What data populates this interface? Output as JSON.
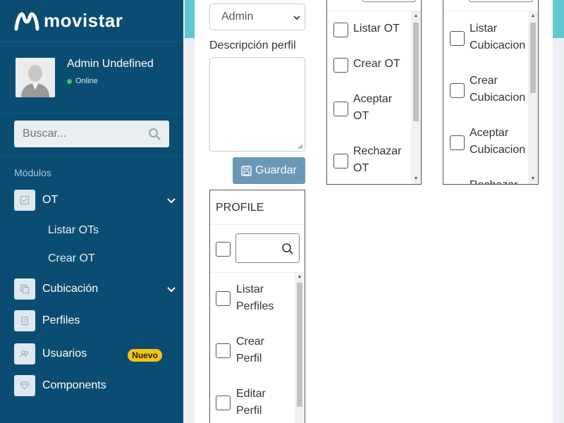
{
  "brand": {
    "name": "movistar",
    "logo_icon": "movistar-m-logo"
  },
  "user": {
    "name": "Admin Undefined",
    "status": "Online",
    "status_color": "#3cc26b"
  },
  "search": {
    "placeholder": "Buscar..."
  },
  "nav": {
    "header": "Módulos",
    "items": [
      {
        "label": "OT",
        "icon": "checkbox-icon",
        "expandable": true
      },
      {
        "label": "Cubicación",
        "icon": "copy-icon",
        "expandable": true
      },
      {
        "label": "Perfiles",
        "icon": "document-icon",
        "expandable": false
      },
      {
        "label": "Usuarios",
        "icon": "users-icon",
        "expandable": false,
        "badge": "Nuevo"
      },
      {
        "label": "Components",
        "icon": "gem-icon",
        "expandable": false
      }
    ],
    "ot_subitems": [
      "Listar OTs",
      "Crear OT"
    ]
  },
  "form": {
    "role_select": "Admin",
    "description_label": "Descripción perfil",
    "save_button": "Guardar"
  },
  "permissions": {
    "profile": {
      "title": "PROFILE",
      "items": [
        [
          "Listar",
          "Perfiles"
        ],
        [
          "Crear",
          "Perfil"
        ],
        [
          "Editar",
          "Perfil"
        ]
      ]
    },
    "ot": {
      "items": [
        [
          "Listar OT"
        ],
        [
          "Crear OT"
        ],
        [
          "Aceptar",
          "OT"
        ],
        [
          "Rechazar",
          "OT"
        ]
      ]
    },
    "cubicacion": {
      "items": [
        [
          "Listar",
          "Cubicacion"
        ],
        [
          "Crear",
          "Cubicacion"
        ],
        [
          "Aceptar",
          "Cubicacion"
        ],
        [
          "Rechazar"
        ]
      ]
    }
  },
  "colors": {
    "sidebar": "#0b4d72",
    "accent": "#5fc7d1",
    "button": "#6b97b7",
    "badge": "#f7c416"
  }
}
